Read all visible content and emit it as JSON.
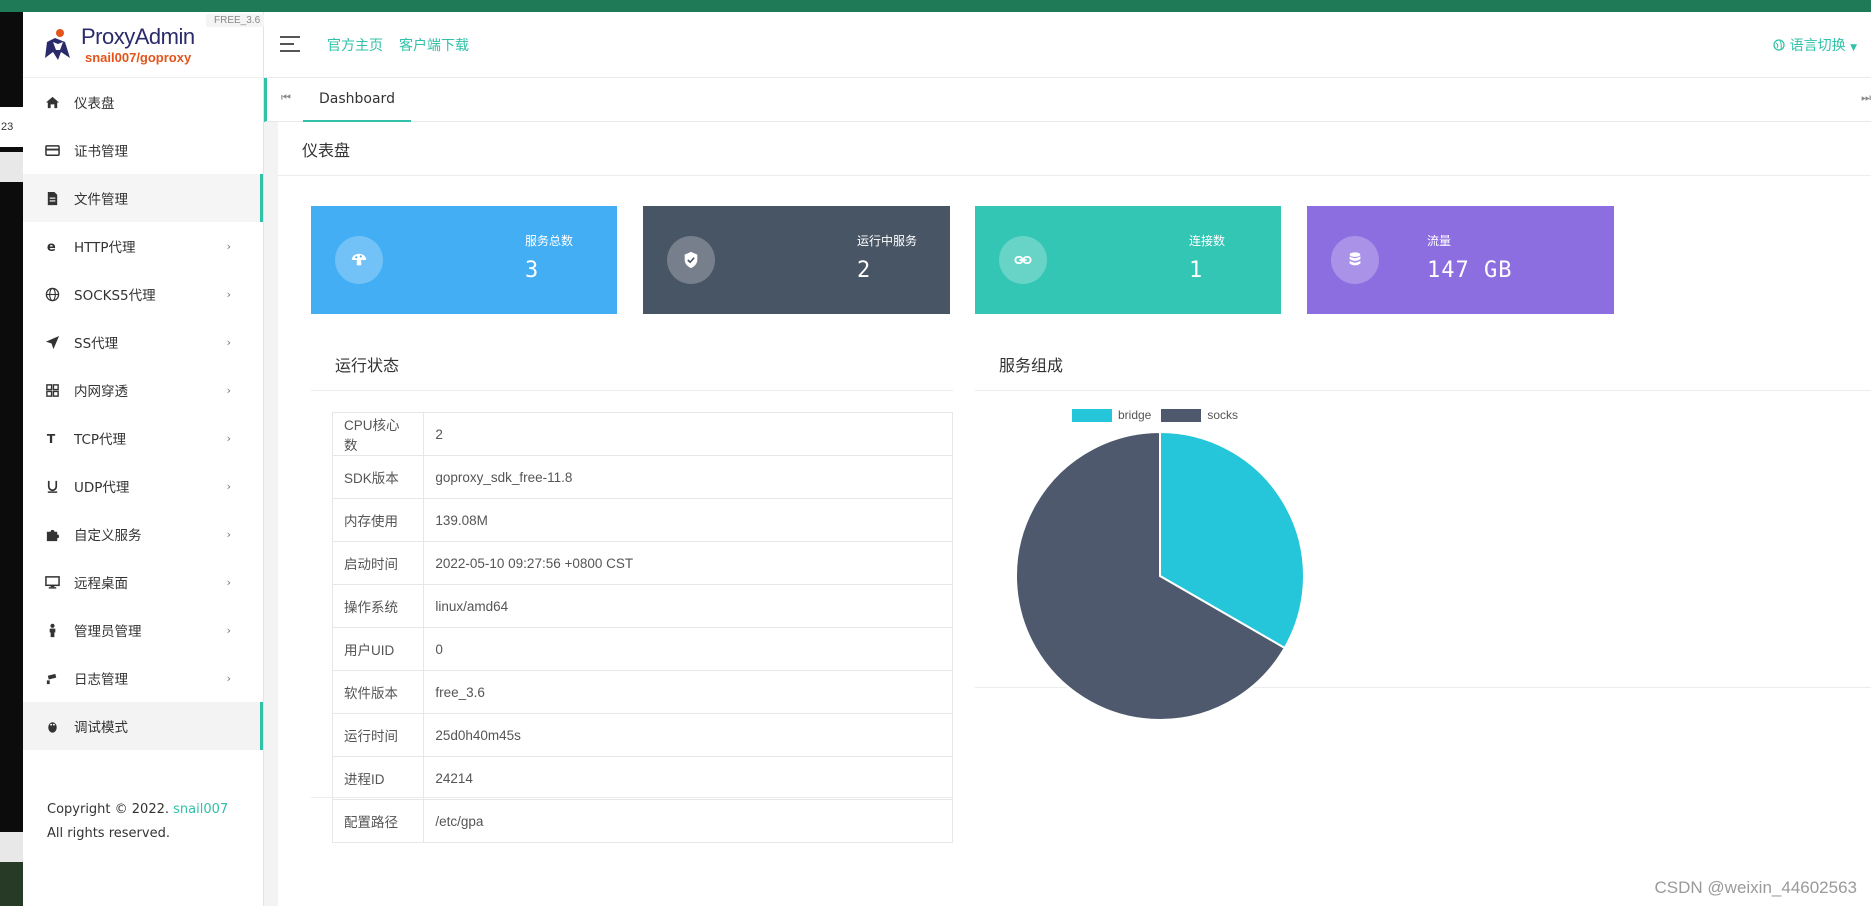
{
  "edge": {
    "clock": "23"
  },
  "logo": {
    "name": "ProxyAdmin",
    "sub": "snail007/goproxy",
    "version": "FREE_3.6"
  },
  "topbar": {
    "link_home": "官方主页",
    "link_download": "客户端下载",
    "language": "语言切换"
  },
  "sidebar": {
    "items": [
      {
        "label": "仪表盘",
        "icon": "home-icon",
        "has_children": false
      },
      {
        "label": "证书管理",
        "icon": "card-icon",
        "has_children": false
      },
      {
        "label": "文件管理",
        "icon": "file-icon",
        "has_children": false
      },
      {
        "label": "HTTP代理",
        "icon": "ie-icon",
        "has_children": true
      },
      {
        "label": "SOCKS5代理",
        "icon": "globe-icon",
        "has_children": true
      },
      {
        "label": "SS代理",
        "icon": "send-icon",
        "has_children": true
      },
      {
        "label": "内网穿透",
        "icon": "network-icon",
        "has_children": true
      },
      {
        "label": "TCP代理",
        "icon": "tcp-icon",
        "has_children": true
      },
      {
        "label": "UDP代理",
        "icon": "udp-icon",
        "has_children": true
      },
      {
        "label": "自定义服务",
        "icon": "puzzle-icon",
        "has_children": true
      },
      {
        "label": "远程桌面",
        "icon": "desktop-icon",
        "has_children": true
      },
      {
        "label": "管理员管理",
        "icon": "user-icon",
        "has_children": true
      },
      {
        "label": "日志管理",
        "icon": "camera-icon",
        "has_children": true
      },
      {
        "label": "调试模式",
        "icon": "bug-icon",
        "has_children": false
      }
    ]
  },
  "copyright": {
    "prefix": "Copyright © 2022. ",
    "link": "snail007",
    "suffix": " All rights reserved."
  },
  "tabs": {
    "active": "Dashboard"
  },
  "page": {
    "title": "仪表盘"
  },
  "stats": [
    {
      "label": "服务总数",
      "value": "3",
      "color": "#44aef5",
      "icon": "mushroom-icon"
    },
    {
      "label": "运行中服务",
      "value": "2",
      "color": "#485565",
      "icon": "shield-check-icon"
    },
    {
      "label": "连接数",
      "value": "1",
      "color": "#34c6b4",
      "icon": "link-icon"
    },
    {
      "label": "流量",
      "value": "147 GB",
      "color": "#8d6ee0",
      "icon": "database-icon"
    }
  ],
  "status": {
    "title": "运行状态",
    "rows": [
      {
        "key": "CPU核心数",
        "value": "2"
      },
      {
        "key": "SDK版本",
        "value": "goproxy_sdk_free-11.8"
      },
      {
        "key": "内存使用",
        "value": "139.08M"
      },
      {
        "key": "启动时间",
        "value": "2022-05-10 09:27:56 +0800 CST"
      },
      {
        "key": "操作系统",
        "value": "linux/amd64"
      },
      {
        "key": "用户UID",
        "value": "0"
      },
      {
        "key": "软件版本",
        "value": "free_3.6"
      },
      {
        "key": "运行时间",
        "value": "25d0h40m45s"
      },
      {
        "key": "进程ID",
        "value": "24214"
      },
      {
        "key": "配置路径",
        "value": "/etc/gpa"
      }
    ]
  },
  "composition": {
    "title": "服务组成"
  },
  "chart_data": {
    "type": "pie",
    "title": "",
    "categories": [
      "bridge",
      "socks"
    ],
    "values": [
      1,
      2
    ],
    "colors": [
      "#26c6da",
      "#4f596d"
    ],
    "legend": "top-center"
  },
  "watermark": "CSDN @weixin_44602563"
}
